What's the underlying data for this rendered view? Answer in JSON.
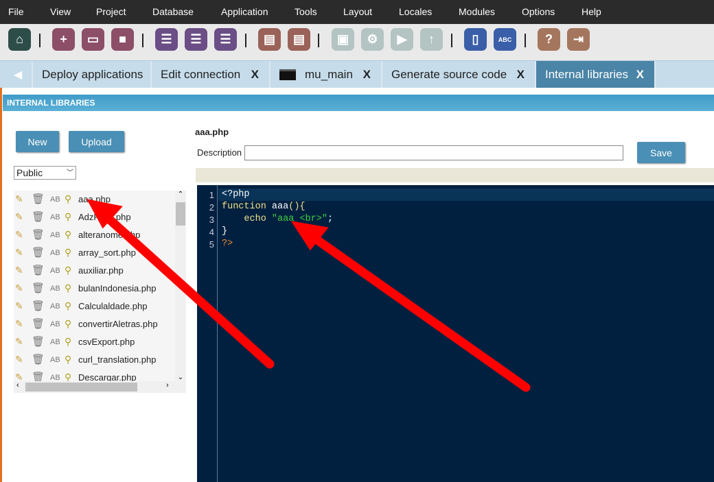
{
  "menu": [
    "File",
    "View",
    "Project",
    "Database",
    "Application",
    "Tools",
    "Layout",
    "Locales",
    "Modules",
    "Options",
    "Help"
  ],
  "toolbar": [
    "home-icon",
    "new-project-icon",
    "open-project-icon",
    "project-box-icon",
    "new-app-icon",
    "edit-app-icon",
    "list-apps-icon",
    "document-icon",
    "documents-icon",
    "save-icon",
    "settings-icon",
    "run-icon",
    "publish-icon",
    "manual-icon",
    "spelling-icon",
    "help-icon",
    "exit-icon"
  ],
  "tabs": [
    {
      "label": "Deploy applications",
      "close": ""
    },
    {
      "label": "Edit connection",
      "close": "X"
    },
    {
      "label": "mu_main",
      "close": "X"
    },
    {
      "label": "Generate source code",
      "close": "X"
    },
    {
      "label": "Internal libraries",
      "close": "X"
    }
  ],
  "panel_title": "INTERNAL LIBRARIES",
  "buttons": {
    "new": "New",
    "upload": "Upload",
    "save": "Save"
  },
  "scope_select": "Public",
  "row_ab": "AB",
  "files": [
    "aaa.php",
    "AdzFunc.php",
    "alteranome.php",
    "array_sort.php",
    "auxiliar.php",
    "bulanIndonesia.php",
    "Calculaldade.php",
    "convertirAletras.php",
    "csvExport.php",
    "curl_translation.php",
    "Descargar.php"
  ],
  "editor": {
    "filename": "aaa.php",
    "description_label": "Description",
    "description_value": "",
    "lines": [
      "1",
      "2",
      "3",
      "4",
      "5"
    ],
    "code": {
      "l1": "<?php",
      "l2_kw": "function ",
      "l2_fn": "aaa",
      "l2_rest": "(){",
      "l3_kw": "    echo ",
      "l3_str": "\"aaa <br>\"",
      "l3_end": ";",
      "l4": "}",
      "l5": "?>"
    }
  }
}
